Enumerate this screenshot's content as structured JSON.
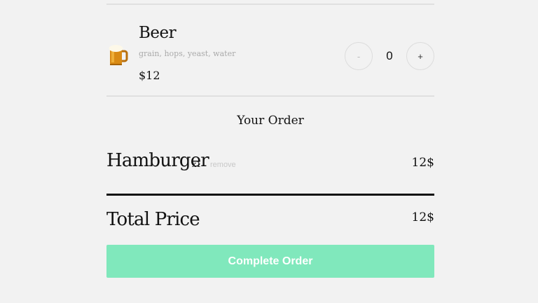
{
  "menu_item": {
    "name": "Beer",
    "ingredients": "grain, hops, yeast, water",
    "price": "$12",
    "icon": "beer-mug-icon",
    "quantity": "0",
    "minus_label": "-",
    "plus_label": "+"
  },
  "order": {
    "heading": "Your Order",
    "items": [
      {
        "name": "Hamburger",
        "quantity": "x1",
        "remove_label": "remove",
        "price": "12$"
      }
    ],
    "total_label": "Total Price",
    "total_value": "12$",
    "complete_label": "Complete Order"
  },
  "colors": {
    "background": "#f2f2f2",
    "accent": "#80e8bc"
  }
}
